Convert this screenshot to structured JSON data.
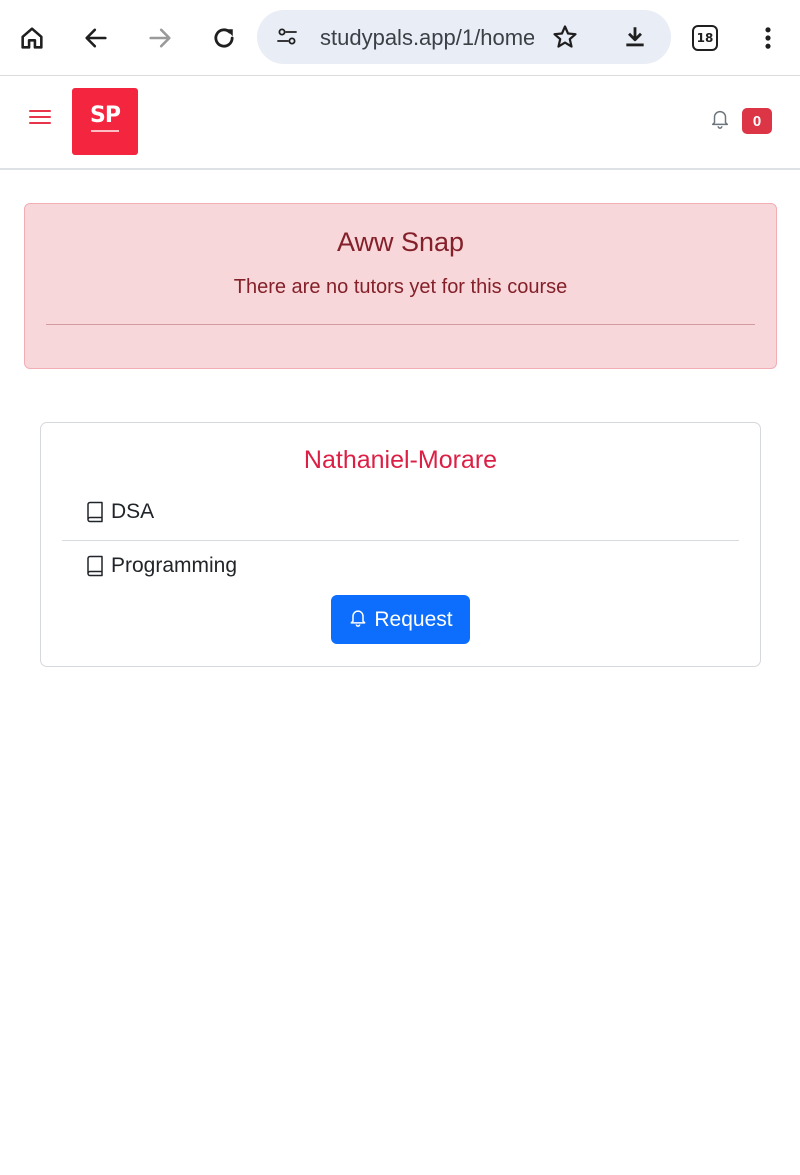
{
  "browser": {
    "url": "studypals.app/1/home",
    "tab_count": "18",
    "icons": [
      "home-icon",
      "back-icon",
      "forward-icon",
      "reload-icon",
      "site-settings-icon",
      "star-icon",
      "download-icon",
      "tabs-icon",
      "more-icon"
    ]
  },
  "navbar": {
    "logo_text": "SP",
    "notification_count": "0",
    "accent_color": "#f4253f",
    "badge_color": "#dc3545"
  },
  "alert": {
    "title": "Aww Snap",
    "message": "There are no tutors yet for this course",
    "background": "#f8d7da",
    "text_color": "#842029"
  },
  "tutor_card": {
    "name": "Nathaniel-Morare",
    "courses": [
      {
        "label": "DSA"
      },
      {
        "label": "Programming"
      }
    ],
    "request_label": "Request",
    "button_color": "#0d6efd"
  }
}
